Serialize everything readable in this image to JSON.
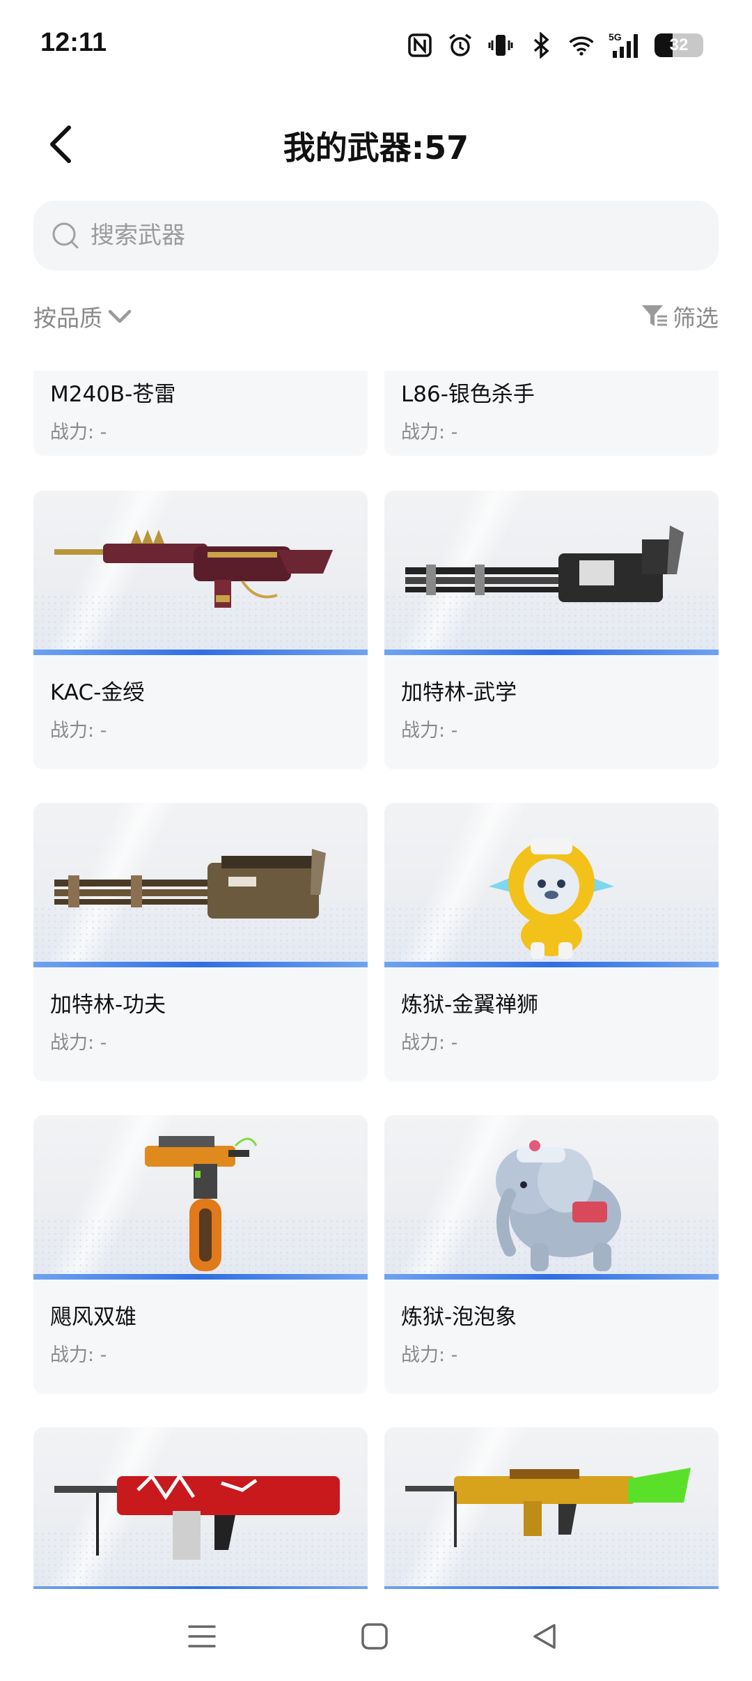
{
  "status_bar": {
    "time": "12:11",
    "battery": "32",
    "icons": [
      "nfc-icon",
      "alarm-icon",
      "vibrate-icon",
      "bluetooth-icon",
      "wifi-icon",
      "signal-5g-icon",
      "battery-icon"
    ]
  },
  "header": {
    "title": "我的武器:57",
    "back_icon": "chevron-left-icon"
  },
  "search": {
    "placeholder": "搜索武器",
    "value": ""
  },
  "sort": {
    "label": "按品质"
  },
  "filter": {
    "label": "筛选"
  },
  "weapons": [
    {
      "name": "M240B-苍雷",
      "power": "战力: -"
    },
    {
      "name": "L86-银色杀手",
      "power": "战力: -"
    },
    {
      "name": "KAC-金绶",
      "power": "战力: -"
    },
    {
      "name": "加特林-武学",
      "power": "战力: -"
    },
    {
      "name": "加特林-功夫",
      "power": "战力: -"
    },
    {
      "name": "炼狱-金翼禅狮",
      "power": "战力: -"
    },
    {
      "name": "飓风双雄",
      "power": "战力: -"
    },
    {
      "name": "炼狱-泡泡象",
      "power": "战力: -"
    },
    {
      "name": "",
      "power": ""
    },
    {
      "name": "",
      "power": ""
    }
  ],
  "nav": [
    "menu-icon",
    "home-icon",
    "back-icon"
  ]
}
